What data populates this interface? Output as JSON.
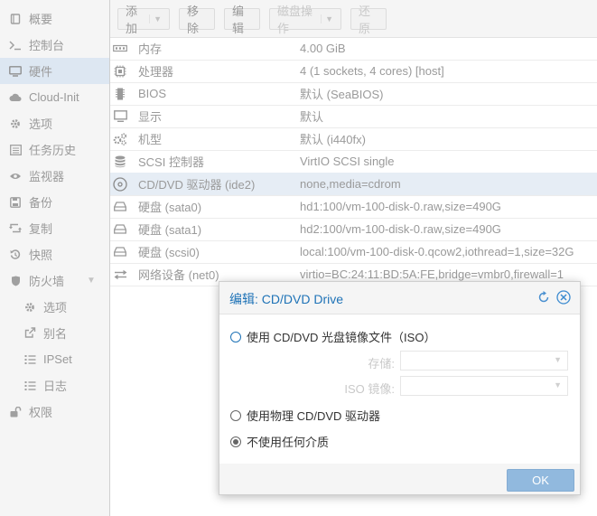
{
  "sidebar": {
    "items": [
      {
        "icon": "book-icon",
        "label": "概要"
      },
      {
        "icon": "terminal-icon",
        "label": "控制台"
      },
      {
        "icon": "desktop-icon",
        "label": "硬件"
      },
      {
        "icon": "cloud-icon",
        "label": "Cloud-Init"
      },
      {
        "icon": "gear-icon",
        "label": "选项"
      },
      {
        "icon": "list-icon",
        "label": "任务历史"
      },
      {
        "icon": "eye-icon",
        "label": "监视器"
      },
      {
        "icon": "floppy-icon",
        "label": "备份"
      },
      {
        "icon": "retweet-icon",
        "label": "复制"
      },
      {
        "icon": "history-icon",
        "label": "快照"
      },
      {
        "icon": "shield-icon",
        "label": "防火墙"
      },
      {
        "icon": "gear-icon",
        "label": "选项"
      },
      {
        "icon": "external-link-icon",
        "label": "别名"
      },
      {
        "icon": "list-ol-icon",
        "label": "IPSet"
      },
      {
        "icon": "list-icon",
        "label": "日志"
      },
      {
        "icon": "unlock-icon",
        "label": "权限"
      }
    ],
    "active": "硬件"
  },
  "toolbar": {
    "add": "添加",
    "remove": "移除",
    "edit": "编辑",
    "disk_action": "磁盘操作",
    "revert": "还原"
  },
  "hardware": {
    "rows": [
      {
        "icon": "memory-icon",
        "key": "内存",
        "value": "4.00 GiB"
      },
      {
        "icon": "cpu-icon",
        "key": "处理器",
        "value": "4 (1 sockets, 4 cores) [host]"
      },
      {
        "icon": "microchip-icon",
        "key": "BIOS",
        "value": "默认 (SeaBIOS)"
      },
      {
        "icon": "desktop-icon",
        "key": "显示",
        "value": "默认"
      },
      {
        "icon": "cogs-icon",
        "key": "机型",
        "value": "默认 (i440fx)"
      },
      {
        "icon": "database-icon",
        "key": "SCSI 控制器",
        "value": "VirtIO SCSI single"
      },
      {
        "icon": "cdrom-icon",
        "key": "CD/DVD 驱动器 (ide2)",
        "value": "none,media=cdrom"
      },
      {
        "icon": "hdd-icon",
        "key": "硬盘 (sata0)",
        "value": "hd1:100/vm-100-disk-0.raw,size=490G"
      },
      {
        "icon": "hdd-icon",
        "key": "硬盘 (sata1)",
        "value": "hd2:100/vm-100-disk-0.raw,size=490G"
      },
      {
        "icon": "hdd-icon",
        "key": "硬盘 (scsi0)",
        "value": "local:100/vm-100-disk-0.qcow2,iothread=1,size=32G"
      },
      {
        "icon": "exchange-icon",
        "key": "网络设备 (net0)",
        "value": "virtio=BC:24:11:BD:5A:FE,bridge=vmbr0,firewall=1"
      }
    ],
    "selected": "CD/DVD 驱动器 (ide2)"
  },
  "dialog": {
    "title": "编辑: CD/DVD Drive",
    "option_iso": "使用 CD/DVD 光盘镜像文件（ISO）",
    "storage_label": "存储:",
    "iso_label": "ISO 镜像:",
    "option_physical": "使用物理 CD/DVD 驱动器",
    "option_none": "不使用任何介质",
    "selected_option": "不使用任何介质",
    "ok": "OK"
  }
}
